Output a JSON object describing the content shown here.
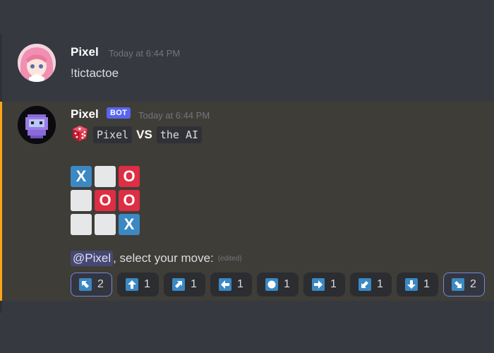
{
  "messages": [
    {
      "username": "Pixel",
      "timestamp": "Today at 6:44 PM",
      "content": "!tictactoe",
      "avatar": "anime-girl-avatar"
    },
    {
      "username": "Pixel",
      "badge": "BOT",
      "timestamp": "Today at 6:44 PM",
      "avatar": "pixel-bot-avatar",
      "title": {
        "emoji": "game-die-icon",
        "player1": "Pixel",
        "vs": "VS",
        "player2": "the AI"
      },
      "board": [
        [
          "X",
          "",
          "O"
        ],
        [
          "",
          "O",
          "O"
        ],
        [
          "",
          "",
          "X"
        ]
      ],
      "prompt": {
        "mention": "@Pixel",
        "text": ", select your move:",
        "edited": "(edited)"
      }
    }
  ],
  "buttons": [
    {
      "icon": "arrow-up-left-icon",
      "count": "2",
      "voted": true
    },
    {
      "icon": "arrow-up-icon",
      "count": "1",
      "voted": false
    },
    {
      "icon": "arrow-up-right-icon",
      "count": "1",
      "voted": false
    },
    {
      "icon": "arrow-left-icon",
      "count": "1",
      "voted": false
    },
    {
      "icon": "center-circle-icon",
      "count": "1",
      "voted": false
    },
    {
      "icon": "arrow-right-icon",
      "count": "1",
      "voted": false
    },
    {
      "icon": "arrow-down-left-icon",
      "count": "1",
      "voted": false
    },
    {
      "icon": "arrow-down-icon",
      "count": "1",
      "voted": false
    },
    {
      "icon": "arrow-down-right-icon",
      "count": "2",
      "voted": true
    }
  ],
  "colors": {
    "background": "#36393f",
    "highlight": "#3f3d38",
    "mention_bar": "#faa61a",
    "bot_badge": "#5865f2",
    "x_tile": "#3b88c3",
    "o_tile": "#dd2e44",
    "empty_tile": "#e6e7e8"
  }
}
